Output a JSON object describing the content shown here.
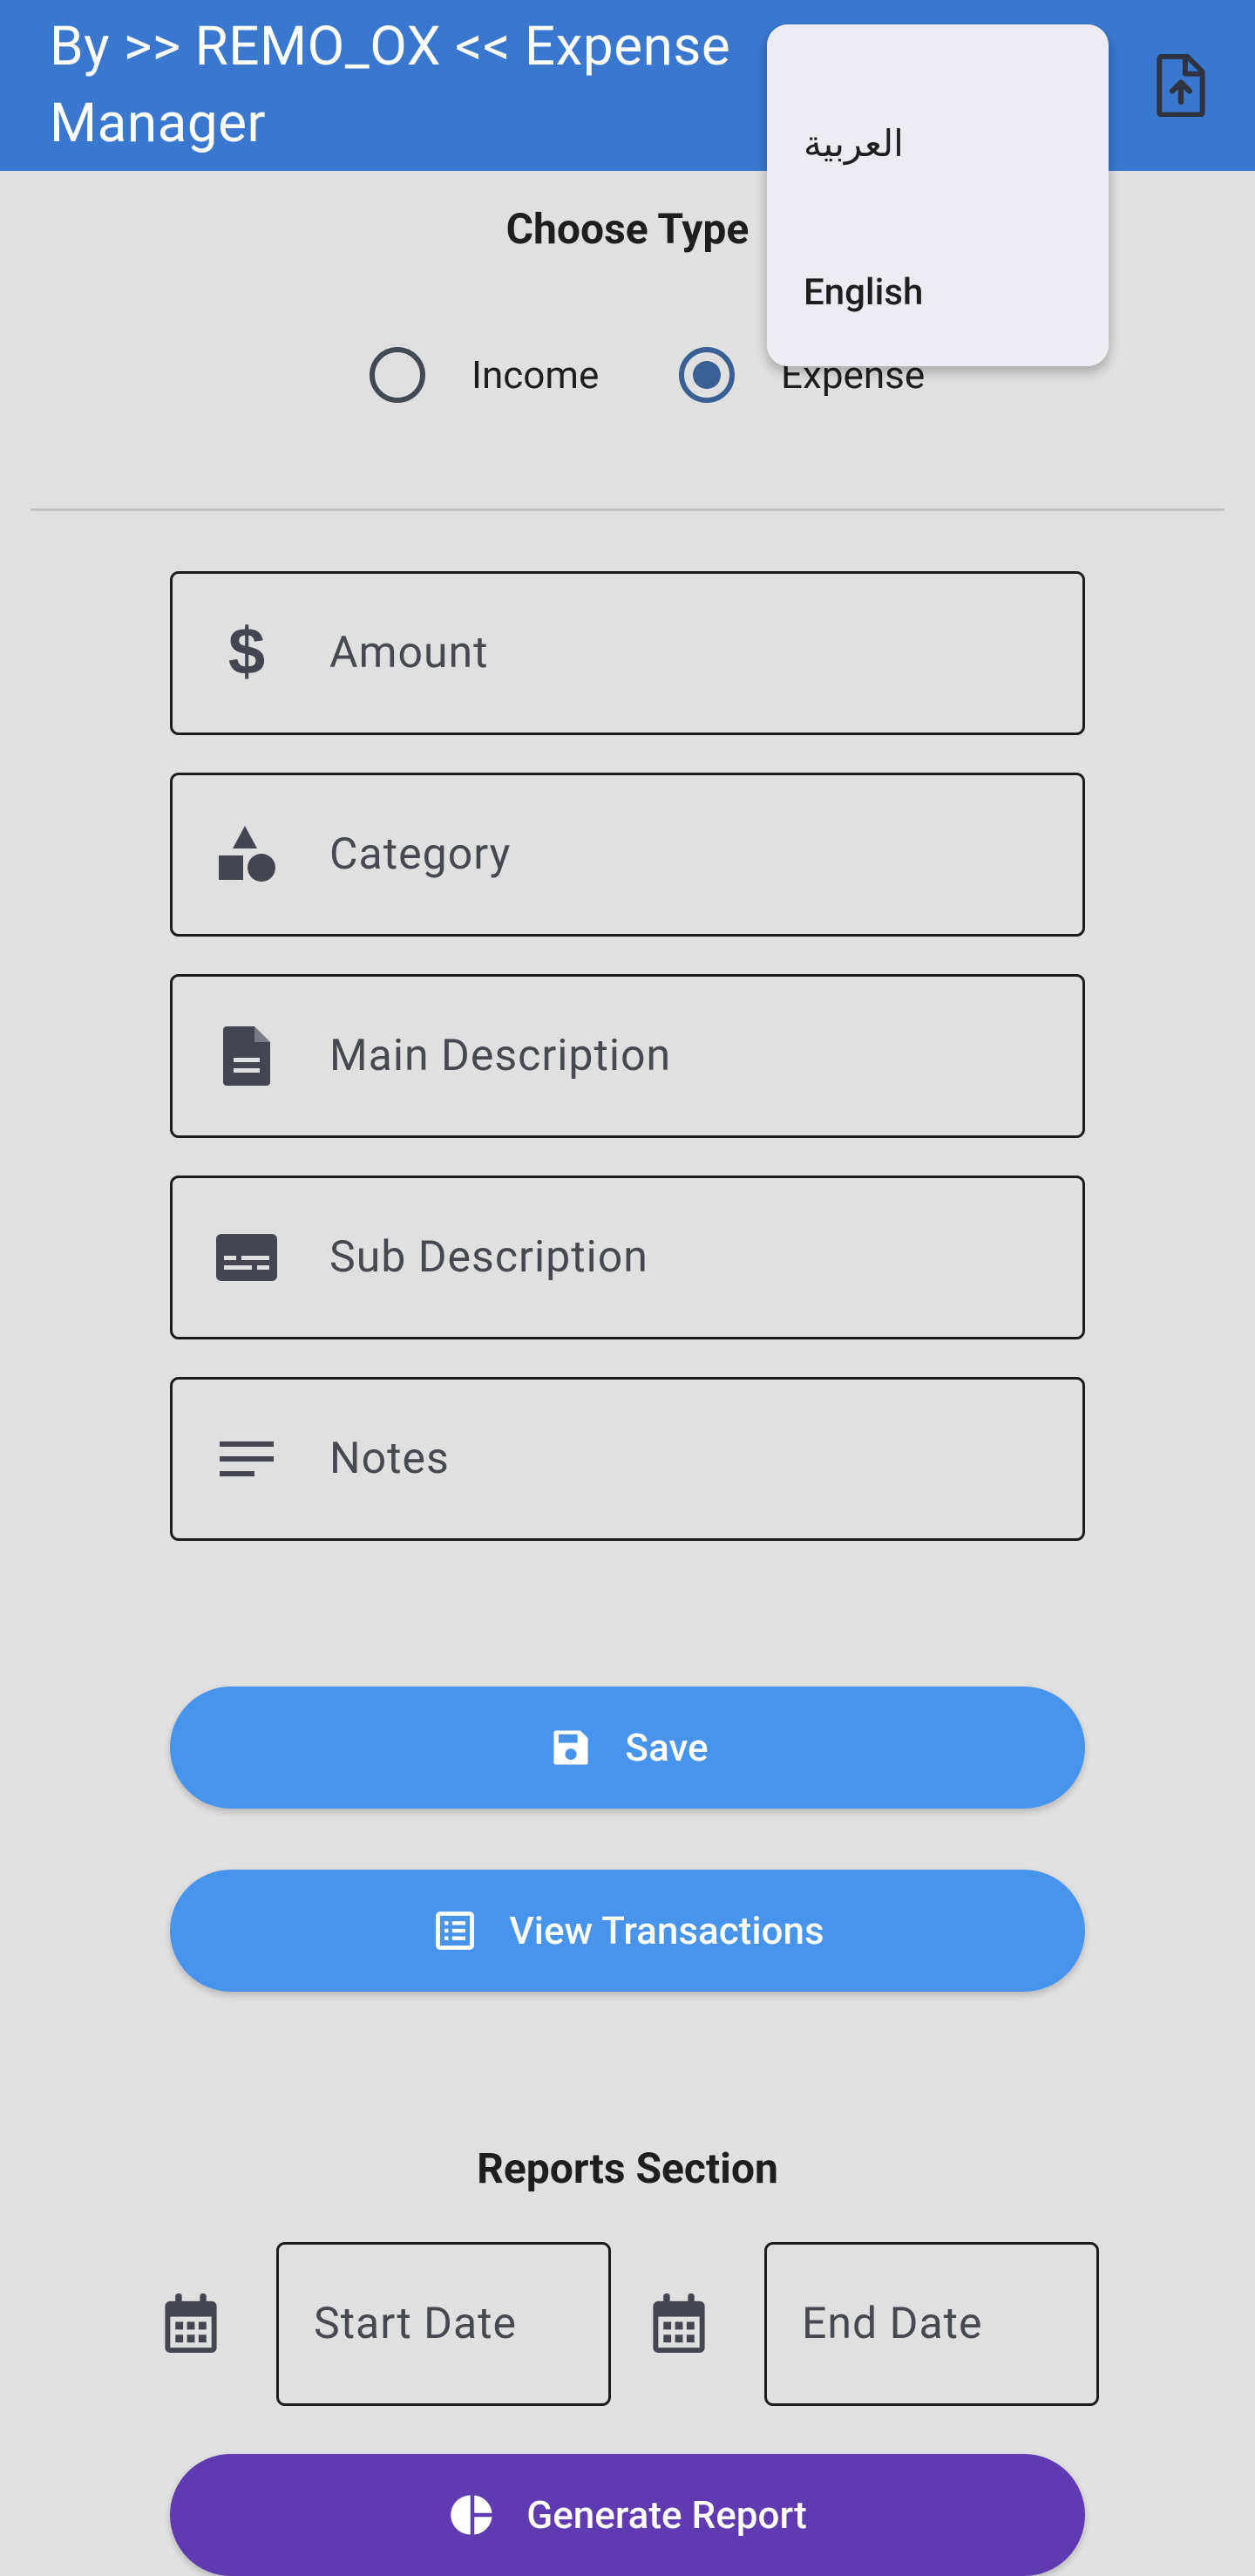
{
  "appbar": {
    "title": "By >> REMO_OX << Expense Manager",
    "action_icon": "file-upload-icon"
  },
  "language_menu": {
    "items": [
      {
        "label": "العربية"
      },
      {
        "label": "English"
      }
    ]
  },
  "type_section": {
    "title": "Choose Type",
    "options": [
      {
        "label": "Income",
        "selected": false
      },
      {
        "label": "Expense",
        "selected": true
      }
    ]
  },
  "form": {
    "fields": [
      {
        "icon": "dollar-icon",
        "placeholder": "Amount",
        "value": ""
      },
      {
        "icon": "category-shapes-icon",
        "placeholder": "Category",
        "value": ""
      },
      {
        "icon": "document-icon",
        "placeholder": "Main Description",
        "value": ""
      },
      {
        "icon": "subtitles-icon",
        "placeholder": "Sub Description",
        "value": ""
      },
      {
        "icon": "notes-lines-icon",
        "placeholder": "Notes",
        "value": ""
      }
    ]
  },
  "actions": {
    "save_label": "Save",
    "save_icon": "save-disk-icon",
    "view_label": "View Transactions",
    "view_icon": "list-alt-icon"
  },
  "reports": {
    "title": "Reports Section",
    "start_placeholder": "Start Date",
    "end_placeholder": "End Date",
    "calendar_icon": "calendar-icon",
    "generate_label": "Generate Report",
    "generate_icon": "pie-chart-icon"
  },
  "colors": {
    "appbar": "#3a78d0",
    "primary_button": "#4894ec",
    "report_button": "#5f3ab0",
    "background": "#e0e0e0",
    "menu": "#ececf2"
  }
}
